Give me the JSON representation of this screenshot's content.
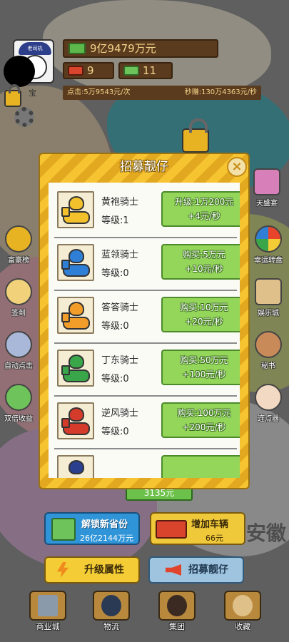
{
  "hud": {
    "money": "9亿9479万元",
    "vehicles": "9",
    "cities": "11",
    "click_income": "点击:5万9543元/次",
    "second_income": "秒赚:130万4363元/秒",
    "avatar_label": "老司机",
    "left_label": "宝"
  },
  "side_left": [
    {
      "label": "富豪榜",
      "icon": "trophy-icon"
    },
    {
      "label": "签到",
      "icon": "calendar-icon"
    },
    {
      "label": "自动点击",
      "icon": "robot-icon"
    },
    {
      "label": "双倍收益",
      "icon": "cash-stack-icon"
    }
  ],
  "side_right": [
    {
      "label": "天盛宴",
      "icon": "party-icon"
    },
    {
      "label": "幸运转盘",
      "icon": "wheel-icon"
    },
    {
      "label": "娱乐城",
      "icon": "game-icon"
    },
    {
      "label": "秘书",
      "icon": "secretary-icon"
    },
    {
      "label": "连点器",
      "icon": "clicker-icon"
    }
  ],
  "modal": {
    "title": "招募靓仔",
    "close": "×",
    "riders": [
      {
        "name": "黄袍骑士",
        "level": "等级:1",
        "btn_line1": "升级:1万200元",
        "btn_line2": "+4元/秒",
        "color": "#f3c12b"
      },
      {
        "name": "蓝领骑士",
        "level": "等级:0",
        "btn_line1": "购买:5万元",
        "btn_line2": "+10元/秒",
        "color": "#2f7fd6"
      },
      {
        "name": "答答骑士",
        "level": "等级:0",
        "btn_line1": "购买:10万元",
        "btn_line2": "+20元/秒",
        "color": "#f29c2a"
      },
      {
        "name": "丁东骑士",
        "level": "等级:0",
        "btn_line1": "购买:50万元",
        "btn_line2": "+100元/秒",
        "color": "#3aa64a"
      },
      {
        "name": "逆风骑士",
        "level": "等级:0",
        "btn_line1": "购买:100万元",
        "btn_line2": "+200元/秒",
        "color": "#d43b2a"
      }
    ]
  },
  "bottom": {
    "pill_value": "3135元",
    "unlock_title": "解锁新省份",
    "unlock_cost": "26亿2144万元",
    "addcar_title": "增加车辆",
    "addcar_cost": "66元",
    "province_text": "安徽",
    "upgrade_attr": "升级属性",
    "recruit": "招募靓仔"
  },
  "nav": [
    {
      "label": "商业城",
      "icon": "city-icon"
    },
    {
      "label": "物流",
      "icon": "globe-icon"
    },
    {
      "label": "集团",
      "icon": "boss-icon"
    },
    {
      "label": "收藏",
      "icon": "collection-icon"
    }
  ]
}
